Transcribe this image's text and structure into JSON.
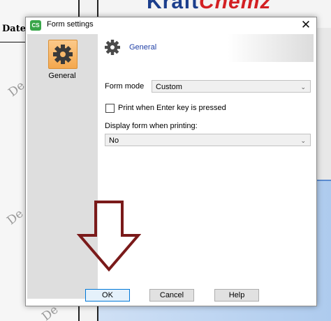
{
  "background": {
    "date_label": "Date #",
    "logo_part1": "Kraft",
    "logo_part2": "Chemz",
    "watermarks": [
      "De",
      "De",
      "De"
    ]
  },
  "dialog": {
    "title": "Form settings",
    "app_icon_text": "CS",
    "close_symbol": "✕"
  },
  "sidebar": {
    "items": [
      {
        "label": "General",
        "icon": "gear-icon",
        "selected": true
      }
    ]
  },
  "content": {
    "section_title": "General",
    "section_icon": "gear-icon",
    "form_mode_label": "Form mode",
    "form_mode_value": "Custom",
    "print_enter_label": "Print when Enter key is pressed",
    "print_enter_checked": false,
    "display_form_label": "Display form when printing:",
    "display_form_value": "No"
  },
  "buttons": {
    "ok": "OK",
    "cancel": "Cancel",
    "help": "Help"
  },
  "annotation": {
    "arrow_color": "#7a1a1a"
  }
}
